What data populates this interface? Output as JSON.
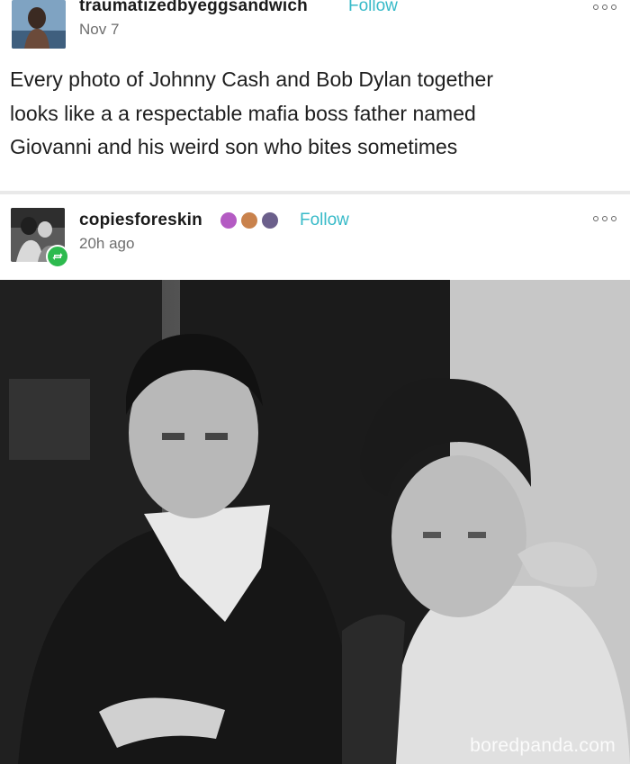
{
  "posts": [
    {
      "username": "traumatizedbyeggsandwich",
      "follow_label": "Follow",
      "time": "Nov 7",
      "body_lines": [
        "Every photo of Johnny Cash and Bob Dylan together",
        "looks like a a respectable mafia boss father named",
        "Giovanni and his weird son who bites sometimes"
      ]
    },
    {
      "username": "copiesforeskin",
      "follow_label": "Follow",
      "time": "20h ago",
      "badges": [
        "#b45bc3",
        "#c9824c",
        "#6b5f8b"
      ]
    }
  ],
  "photo": {
    "watermark": "boredpanda.com"
  },
  "colors": {
    "follow": "#37bac8",
    "reblog_badge": "#2dba4e"
  }
}
